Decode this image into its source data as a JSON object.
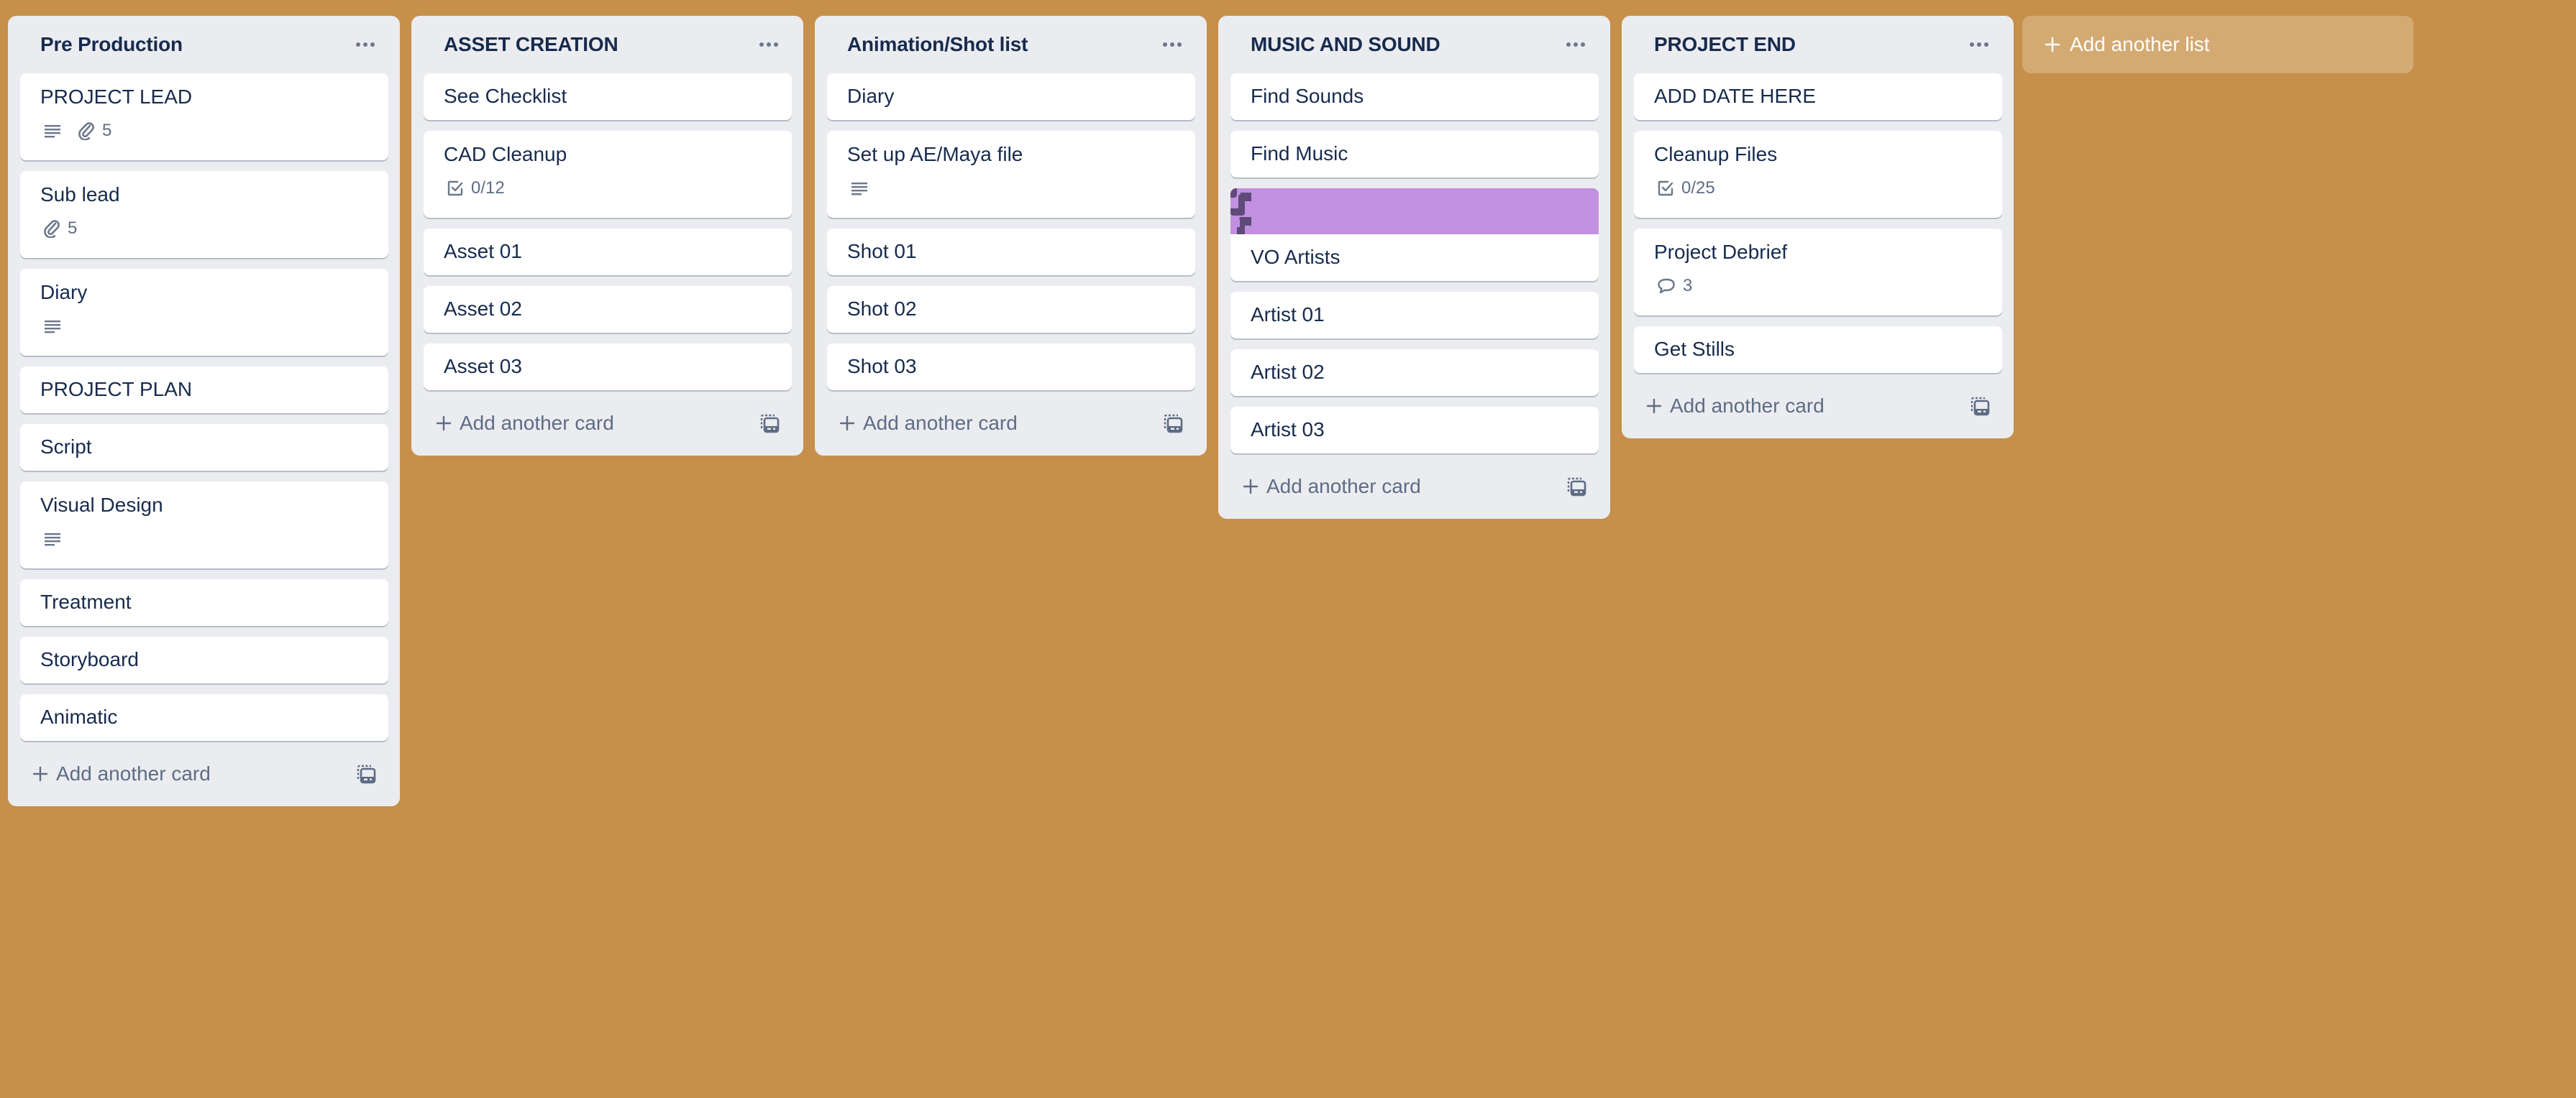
{
  "board": {
    "background_color": "#c6904a",
    "lists": [
      {
        "title": "Pre Production",
        "cards": [
          {
            "title": "PROJECT LEAD",
            "badges": {
              "description": true,
              "attachments": "5"
            }
          },
          {
            "title": "Sub lead",
            "badges": {
              "attachments": "5"
            }
          },
          {
            "title": "Diary",
            "badges": {
              "description": true
            }
          },
          {
            "title": "PROJECT PLAN"
          },
          {
            "title": "Script"
          },
          {
            "title": "Visual Design",
            "badges": {
              "description": true
            }
          },
          {
            "title": "Treatment"
          },
          {
            "title": "Storyboard"
          },
          {
            "title": "Animatic"
          }
        ],
        "add_card_label": "Add another card"
      },
      {
        "title": "ASSET CREATION",
        "cards": [
          {
            "title": "See Checklist"
          },
          {
            "title": "CAD Cleanup",
            "badges": {
              "checklist": "0/12"
            }
          },
          {
            "title": "Asset 01"
          },
          {
            "title": "Asset 02"
          },
          {
            "title": "Asset 03"
          }
        ],
        "add_card_label": "Add another card"
      },
      {
        "title": "Animation/Shot list",
        "cards": [
          {
            "title": "Diary"
          },
          {
            "title": "Set up AE/Maya file",
            "badges": {
              "description": true
            }
          },
          {
            "title": "Shot 01"
          },
          {
            "title": "Shot 02"
          },
          {
            "title": "Shot 03"
          }
        ],
        "add_card_label": "Add another card"
      },
      {
        "title": "MUSIC AND SOUND",
        "cards": [
          {
            "title": "Find Sounds"
          },
          {
            "title": "Find Music"
          },
          {
            "title": "VO Artists",
            "cover": {
              "color": "#c190e0",
              "pattern_color": "#5f4a79"
            }
          },
          {
            "title": "Artist 01"
          },
          {
            "title": "Artist 02"
          },
          {
            "title": "Artist 03"
          }
        ],
        "add_card_label": "Add another card"
      },
      {
        "title": "PROJECT END",
        "cards": [
          {
            "title": "ADD DATE HERE"
          },
          {
            "title": "Cleanup Files",
            "badges": {
              "checklist": "0/25"
            }
          },
          {
            "title": "Project Debrief",
            "badges": {
              "comments": "3"
            }
          },
          {
            "title": "Get Stills"
          }
        ],
        "add_card_label": "Add another card"
      }
    ],
    "add_list_label": "Add another list"
  },
  "icons": {
    "list_menu": "more-horizontal-icon",
    "description": "description-icon",
    "attachment": "paperclip-icon",
    "checklist": "checklist-icon",
    "comment": "comment-icon",
    "add": "plus-icon",
    "template": "card-template-icon"
  }
}
